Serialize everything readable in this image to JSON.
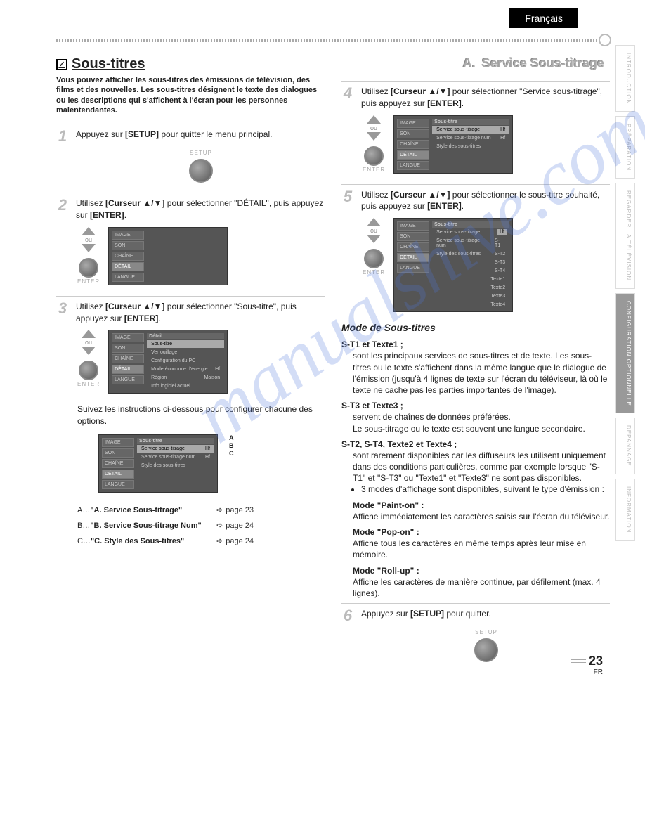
{
  "header": {
    "language": "Français"
  },
  "sideTabs": {
    "t1": "INTRODUCTION",
    "t2": "PRÉPARATION",
    "t3": "REGARDER LA TÉLÉVISION",
    "t4": "CONFIGURATION OPTIONNELLE",
    "t5": "DÉPANNAGE",
    "t6": "INFORMATION"
  },
  "left": {
    "title": "Sous-titres",
    "intro": "Vous pouvez afficher les sous-titres des émissions de télévision, des films et des nouvelles. Les sous-titres désignent le texte des dialogues ou les descriptions qui s'affichent à l'écran pour les personnes malentendantes.",
    "step1": {
      "num": "1",
      "t1": "Appuyez sur ",
      "b1": "[SETUP]",
      "t2": " pour quitter le menu principal.",
      "btnLabel": "SETUP"
    },
    "step2": {
      "num": "2",
      "t1": "Utilisez ",
      "b1": "[Curseur ▲/▼]",
      "t2": " pour sélectionner \"DÉTAIL\", puis appuyez sur ",
      "b2": "[ENTER]",
      "t3": ".",
      "ou": "ou",
      "btnLabel": "ENTER"
    },
    "step3": {
      "num": "3",
      "t1": "Utilisez ",
      "b1": "[Curseur ▲/▼]",
      "t2": " pour sélectionner \"Sous-titre\", puis appuyez sur ",
      "b2": "[ENTER]",
      "t3": ".",
      "ou": "ou",
      "btnLabel": "ENTER"
    },
    "follow": "Suivez les instructions ci-dessous pour configurer chacune des options.",
    "osd2": {
      "m1": "IMAGE",
      "m2": "SON",
      "m3": "CHAÎNE",
      "m4": "DÉTAIL",
      "m5": "LANGUE"
    },
    "osd3": {
      "header": "Détail",
      "r1": "Sous-titre",
      "r2": "Verrouillage",
      "r3": "Configuration du PC",
      "r4": "Mode économie d'énergie",
      "r4v": "Hf",
      "r5": "Région",
      "r5v": "Maison",
      "r6": "Info logiciel actuel"
    },
    "osd4": {
      "header": "Sous-titre",
      "r1": "Service sous-titrage",
      "r1v": "Hf",
      "r2": "Service sous-titrage num",
      "r2v": "Hf",
      "r3": "Style des sous-titres"
    },
    "abc": {
      "a": "A",
      "b": "B",
      "c": "C"
    },
    "legend": {
      "a": {
        "k": "A…",
        "t": "\"A. Service Sous-titrage\"",
        "p": "page 23"
      },
      "b": {
        "k": "B…",
        "t": "\"B. Service Sous-titrage Num\"",
        "p": "page 24"
      },
      "c": {
        "k": "C…",
        "t": "\"C. Style des Sous-titres\"",
        "p": "page 24"
      }
    }
  },
  "right": {
    "title": {
      "letter": "A.",
      "text": "Service Sous-titrage"
    },
    "step4": {
      "num": "4",
      "t1": "Utilisez ",
      "b1": "[Curseur ▲/▼]",
      "t2": " pour sélectionner \"Service sous-titrage\", puis appuyez sur ",
      "b2": "[ENTER]",
      "t3": ".",
      "ou": "ou",
      "btnLabel": "ENTER"
    },
    "osd4b": {
      "header": "Sous-titre",
      "r1": "Service sous-titrage",
      "r1v": "Hf",
      "r2": "Service sous-titrage num",
      "r2v": "Hf",
      "r3": "Style des sous-titres"
    },
    "step5": {
      "num": "5",
      "t1": "Utilisez ",
      "b1": "[Curseur ▲/▼]",
      "t2": " pour sélectionner le sous-titre souhaité, puis appuyez sur ",
      "b2": "[ENTER]",
      "t3": ".",
      "ou": "ou",
      "btnLabel": "ENTER"
    },
    "osd5": {
      "header": "Sous-titre",
      "r1": "Service sous-titrage",
      "r1v": "Hf",
      "r2": "Service sous-titrage num",
      "r2v": "S-T1",
      "r3": "Style des sous-titres",
      "r3v": "S-T2",
      "v4": "S-T3",
      "v5": "S-T4",
      "v6": "Texte1",
      "v7": "Texte2",
      "v8": "Texte3",
      "v9": "Texte4"
    },
    "modeHead": "Mode de Sous-titres",
    "m1": {
      "h": "S-T1 et Texte1 ;",
      "b": "sont les principaux services de sous-titres et de texte. Les sous-titres ou le texte s'affichent dans la même langue que le dialogue de l'émission (jusqu'à 4 lignes de texte sur l'écran du téléviseur, là où le texte ne cache pas les parties importantes de l'image)."
    },
    "m2": {
      "h": "S-T3 et Texte3 ;",
      "b1": "servent de chaînes de données préférées.",
      "b2": "Le sous-titrage ou le texte est souvent une langue secondaire."
    },
    "m3": {
      "h": "S-T2, S-T4, Texte2 et Texte4 ;",
      "b": "sont rarement disponibles car les diffuseurs les utilisent uniquement dans des conditions particulières, comme par exemple lorsque \"S-T1\" et \"S-T3\" ou \"Texte1\" et \"Texte3\" ne sont pas disponibles.",
      "bullet": "3 modes d'affichage sont disponibles, suivant le type d'émission :"
    },
    "paint": {
      "h": "Mode \"Paint-on\" :",
      "b": "Affiche immédiatement les caractères saisis sur l'écran du téléviseur."
    },
    "pop": {
      "h": "Mode \"Pop-on\" :",
      "b": "Affiche tous les caractères en même temps après leur mise en mémoire."
    },
    "roll": {
      "h": "Mode \"Roll-up\" :",
      "b": "Affiche les caractères de manière continue, par défilement (max. 4 lignes)."
    },
    "step6": {
      "num": "6",
      "t1": "Appuyez sur ",
      "b1": "[SETUP]",
      "t2": " pour quitter.",
      "btnLabel": "SETUP"
    }
  },
  "footer": {
    "page": "23",
    "lang": "FR"
  },
  "watermark": "manualshive.com"
}
